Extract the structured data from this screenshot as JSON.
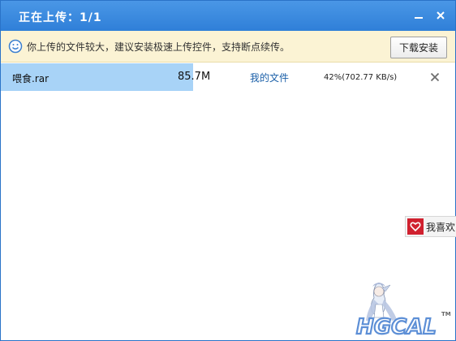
{
  "window": {
    "title": "正在上传：1/1",
    "minimize_icon": "minimize-icon",
    "close_icon": "close-icon"
  },
  "notice": {
    "icon": "smiley-icon",
    "text": "你上传的文件较大，建议安装极速上传控件，支持断点续传。",
    "install_button": "下载安装"
  },
  "uploads": [
    {
      "filename": "喂食.rar",
      "size": "85.7M",
      "destination": "我的文件",
      "progress_percent": 42,
      "progress_text": "42%(702.77 KB/s)",
      "close_icon": "close-icon"
    }
  ],
  "like_button": {
    "icon": "heart-icon",
    "label": "我喜欢"
  },
  "watermark": {
    "text": "HGCAL",
    "tm": "TM",
    "colors": {
      "accent": "#5d8fd6"
    }
  },
  "colors": {
    "titlebar": "#3a8ae0",
    "notice_bg": "#fbf3d4",
    "progress_fill": "#a8d3f7",
    "link": "#1a5fa8",
    "like_red": "#d0212f"
  }
}
